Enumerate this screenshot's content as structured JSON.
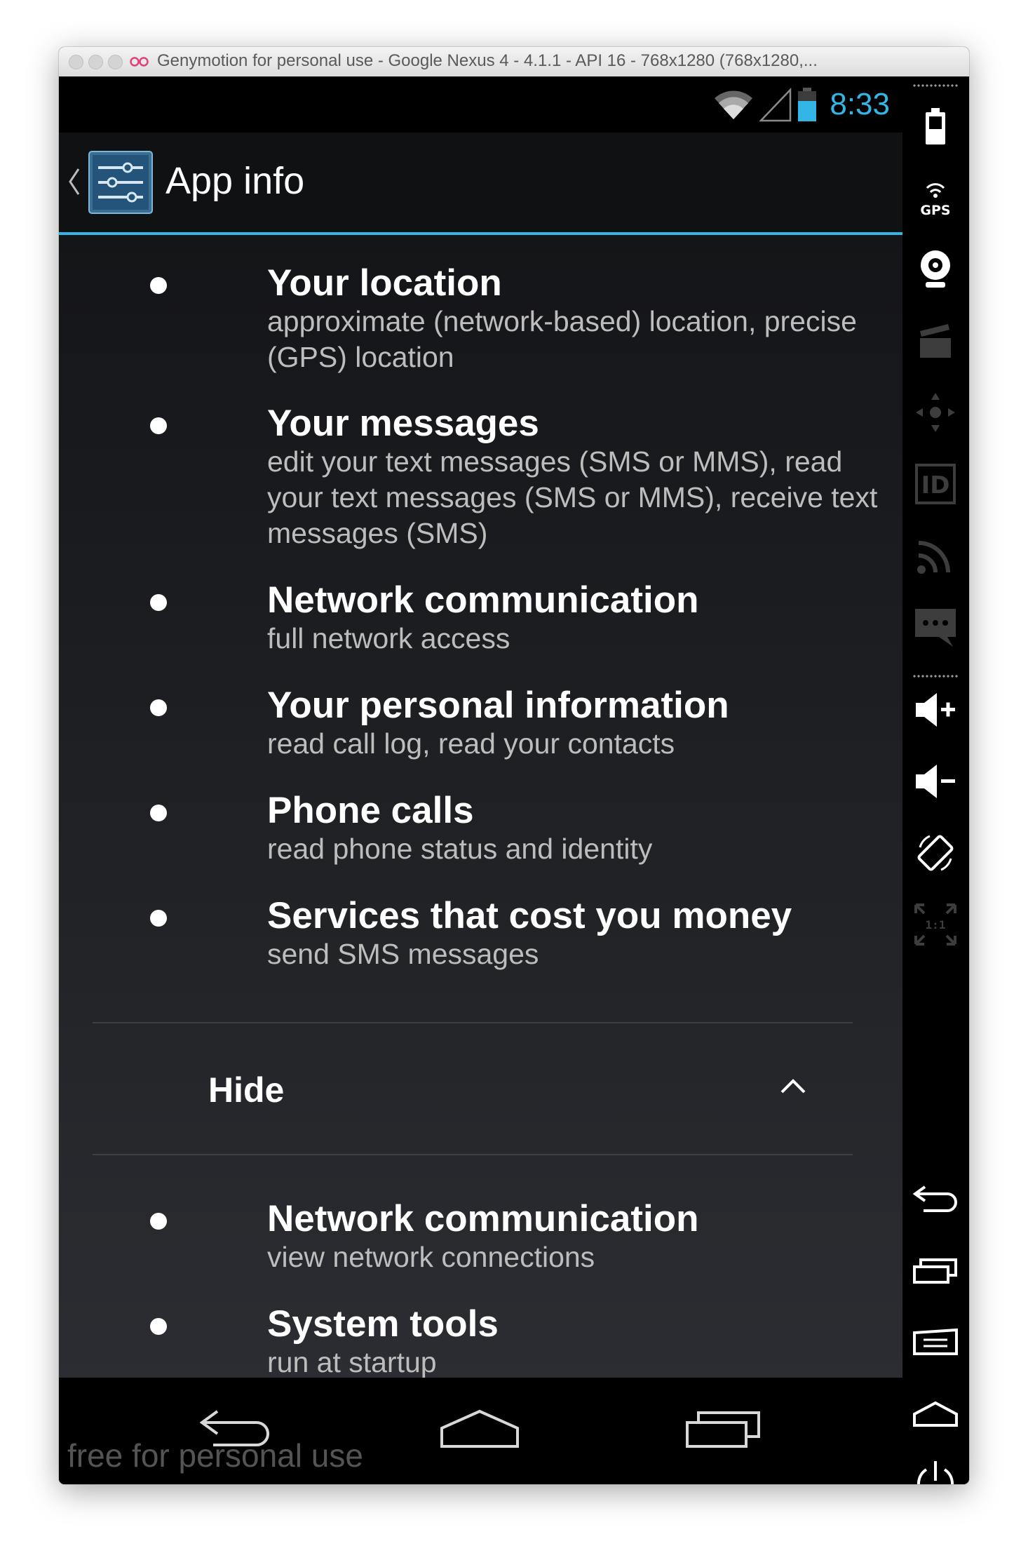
{
  "window": {
    "title": "Genymotion for personal use - Google Nexus 4 - 4.1.1 - API 16 - 768x1280 (768x1280,..."
  },
  "status_bar": {
    "time": "8:33",
    "icons": [
      "wifi-icon",
      "cell-signal-icon",
      "battery-icon"
    ]
  },
  "action_bar": {
    "title": "App info",
    "icon": "settings-sliders-icon"
  },
  "permissions_top": [
    {
      "title": "Your location",
      "desc": "approximate (network-based) location, precise (GPS) location"
    },
    {
      "title": "Your messages",
      "desc": "edit your text messages (SMS or MMS), read your text messages (SMS or MMS), receive text messages (SMS)"
    },
    {
      "title": "Network communication",
      "desc": "full network access"
    },
    {
      "title": "Your personal information",
      "desc": "read call log, read your contacts"
    },
    {
      "title": "Phone calls",
      "desc": "read phone status and identity"
    },
    {
      "title": "Services that cost you money",
      "desc": "send SMS messages"
    }
  ],
  "toggle": {
    "label": "Hide",
    "icon": "chevron-up-icon"
  },
  "permissions_bottom": [
    {
      "title": "Network communication",
      "desc": "view network connections"
    },
    {
      "title": "System tools",
      "desc": "run at startup"
    }
  ],
  "nav_bar": {
    "buttons": [
      "back-icon",
      "home-icon",
      "recents-icon"
    ],
    "watermark": "free for personal use"
  },
  "sidebar": {
    "tools": [
      "battery-widget-icon",
      "gps-widget-icon",
      "camera-widget-icon",
      "media-widget-icon",
      "dpad-widget-icon",
      "device-id-widget-icon",
      "network-widget-icon",
      "sms-widget-icon",
      "volume-up-icon",
      "volume-down-icon",
      "rotate-icon",
      "pixel-perfect-icon",
      "back-icon",
      "recents-icon",
      "menu-icon",
      "home-icon",
      "power-icon"
    ],
    "gps_label": "GPS",
    "id_label": "ID",
    "scale_label": "1:1"
  },
  "colors": {
    "accent": "#33b5e5",
    "background": "#1a1b1e",
    "text_primary": "#ffffff",
    "text_secondary": "#bdbdbd"
  }
}
